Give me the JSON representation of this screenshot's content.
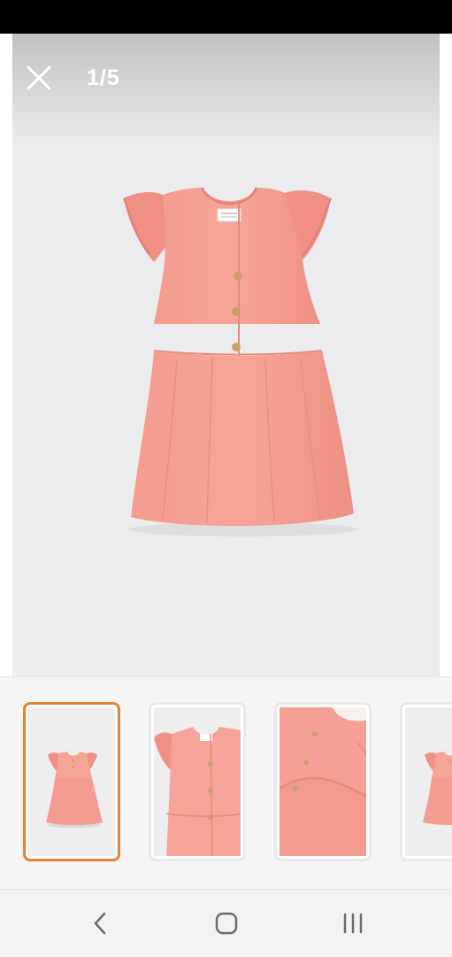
{
  "viewer": {
    "counter": "1/5",
    "main_image": "pink-flutter-sleeve-dress-photo"
  },
  "icons": {
    "close": "close-icon",
    "back": "back-icon",
    "home": "home-icon",
    "recents": "recents-icon"
  },
  "thumbnails": [
    {
      "image": "full-dress",
      "selected": true
    },
    {
      "image": "dress-bodice-buttons",
      "selected": false
    },
    {
      "image": "dress-button-detail",
      "selected": false
    },
    {
      "image": "full-dress",
      "selected": false
    }
  ],
  "colors": {
    "dress": "#f2968a",
    "dress_shadow": "#e07f75",
    "button": "#c9a06a",
    "accent_selected": "#e8812f"
  }
}
